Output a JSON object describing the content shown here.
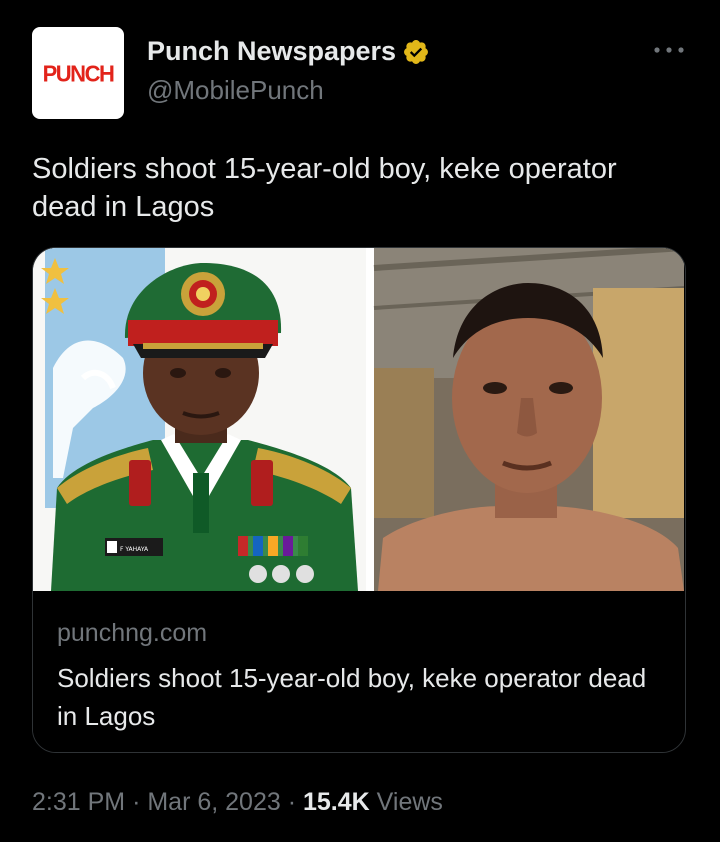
{
  "account": {
    "logo_text": "PUNCH",
    "display_name": "Punch Newspapers",
    "handle": "@MobilePunch"
  },
  "tweet": {
    "text": "Soldiers shoot 15-year-old boy, keke operator dead in Lagos"
  },
  "card": {
    "left_image_caption": "F YAHAYA",
    "domain": "punchng.com",
    "title": "Soldiers shoot 15-year-old boy, keke operator dead in Lagos"
  },
  "meta": {
    "time": "2:31 PM",
    "separator": "·",
    "date": "Mar 6, 2023",
    "views_count": "15.4K",
    "views_label": "Views"
  },
  "colors": {
    "background": "#000000",
    "primary_text": "#e7e9ea",
    "secondary_text": "#71767b",
    "border": "#2f3336",
    "verified_gold": "#e2b719",
    "punch_red": "#e2231a"
  },
  "icons": {
    "verified": "verified-badge-icon",
    "more": "more-options-icon"
  }
}
